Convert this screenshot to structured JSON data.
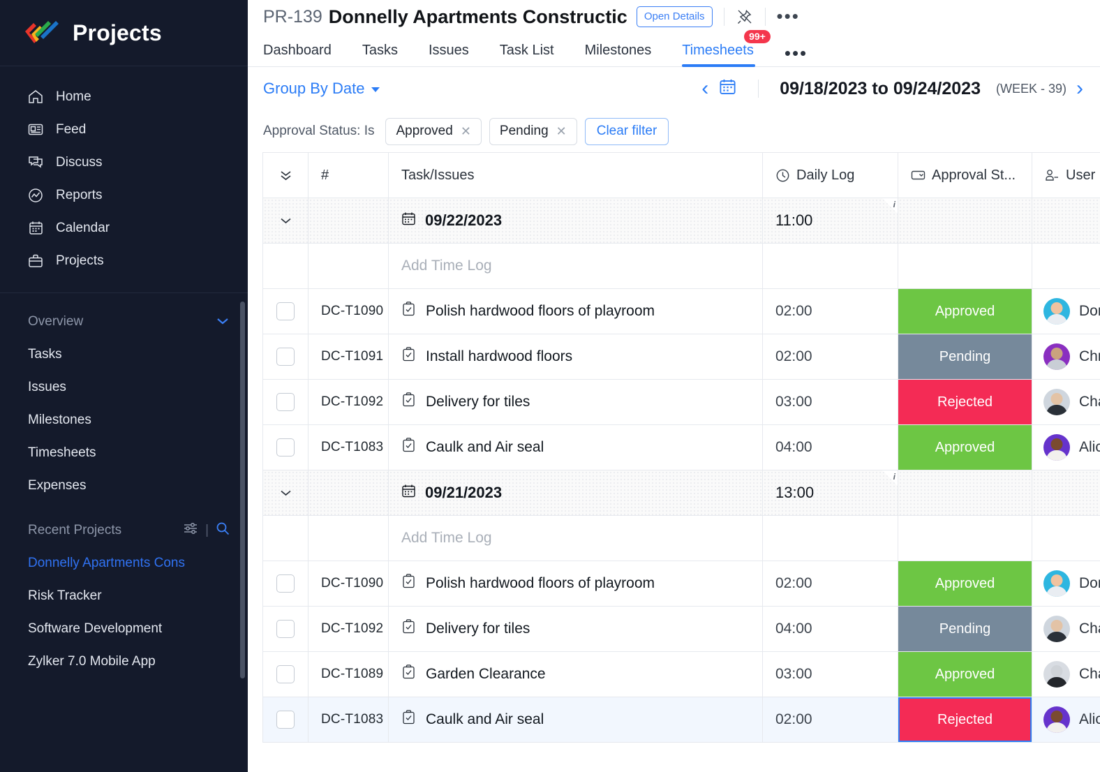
{
  "sidebar": {
    "brand": "Projects",
    "nav": [
      {
        "label": "Home",
        "icon": "home-icon"
      },
      {
        "label": "Feed",
        "icon": "feed-icon"
      },
      {
        "label": "Discuss",
        "icon": "discuss-icon"
      },
      {
        "label": "Reports",
        "icon": "reports-icon"
      },
      {
        "label": "Calendar",
        "icon": "calendar-icon"
      },
      {
        "label": "Projects",
        "icon": "briefcase-icon"
      }
    ],
    "overview": {
      "title": "Overview",
      "items": [
        {
          "label": "Tasks"
        },
        {
          "label": "Issues"
        },
        {
          "label": "Milestones"
        },
        {
          "label": "Timesheets"
        },
        {
          "label": "Expenses"
        }
      ]
    },
    "recent": {
      "title": "Recent Projects",
      "items": [
        {
          "label": "Donnelly Apartments Cons",
          "active": true
        },
        {
          "label": "Risk Tracker",
          "active": false
        },
        {
          "label": "Software Development",
          "active": false
        },
        {
          "label": "Zylker 7.0 Mobile App",
          "active": false
        }
      ]
    }
  },
  "header": {
    "project_id": "PR-139",
    "project_name": "Donnelly Apartments Constructic",
    "open_details_label": "Open Details",
    "pin_icon": "unpin-icon",
    "more_icon": "more-options-icon"
  },
  "tabs": [
    {
      "label": "Dashboard",
      "active": false
    },
    {
      "label": "Tasks",
      "active": false
    },
    {
      "label": "Issues",
      "active": false
    },
    {
      "label": "Task List",
      "active": false
    },
    {
      "label": "Milestones",
      "active": false
    },
    {
      "label": "Timesheets",
      "active": true,
      "badge": "99+"
    }
  ],
  "toolbar": {
    "group_by_label": "Group By Date",
    "date_range": "09/18/2023 to 09/24/2023",
    "week_label": "(WEEK - 39)",
    "prev_icon": "chevron-left-icon",
    "next_icon": "chevron-right-icon",
    "calendar_icon": "calendar-picker-icon"
  },
  "filters": {
    "label": "Approval Status: Is",
    "chips": [
      {
        "label": "Approved"
      },
      {
        "label": "Pending"
      }
    ],
    "clear_label": "Clear filter"
  },
  "table": {
    "columns": [
      {
        "key": "expand",
        "label": "",
        "icon": "collapse-all-icon"
      },
      {
        "key": "num",
        "label": "#",
        "icon": ""
      },
      {
        "key": "task",
        "label": "Task/Issues",
        "icon": ""
      },
      {
        "key": "log",
        "label": "Daily Log",
        "icon": "clock-icon"
      },
      {
        "key": "approval",
        "label": "Approval St...",
        "icon": "dropdown-field-icon"
      },
      {
        "key": "user",
        "label": "User",
        "icon": "user-icon"
      }
    ],
    "add_time_log_label": "Add Time Log",
    "groups": [
      {
        "date": "09/22/2023",
        "total": "11:00",
        "rows": [
          {
            "id": "DC-T1090",
            "task": "Polish hardwood floors of playroom",
            "log": "02:00",
            "status": "Approved",
            "status_key": "approved",
            "user": "Don",
            "avatar_color": "#2eb6e0",
            "selected": false
          },
          {
            "id": "DC-T1091",
            "task": "Install hardwood floors",
            "log": "02:00",
            "status": "Pending",
            "status_key": "pending",
            "user": "Chr",
            "avatar_color": "#8a2fc0",
            "selected": false
          },
          {
            "id": "DC-T1092",
            "task": "Delivery for tiles",
            "log": "03:00",
            "status": "Rejected",
            "status_key": "rejected",
            "user": "Cha",
            "avatar_color": "#cfd6de",
            "selected": false
          },
          {
            "id": "DC-T1083",
            "task": "Caulk and Air seal",
            "log": "04:00",
            "status": "Approved",
            "status_key": "approved",
            "user": "Alic",
            "avatar_color": "#6633cc",
            "selected": false
          }
        ]
      },
      {
        "date": "09/21/2023",
        "total": "13:00",
        "rows": [
          {
            "id": "DC-T1090",
            "task": "Polish hardwood floors of playroom",
            "log": "02:00",
            "status": "Approved",
            "status_key": "approved",
            "user": "Don",
            "avatar_color": "#2eb6e0",
            "selected": false
          },
          {
            "id": "DC-T1092",
            "task": "Delivery for tiles",
            "log": "04:00",
            "status": "Pending",
            "status_key": "pending",
            "user": "Cha",
            "avatar_color": "#cfd6de",
            "selected": false
          },
          {
            "id": "DC-T1089",
            "task": "Garden Clearance",
            "log": "03:00",
            "status": "Approved",
            "status_key": "approved",
            "user": "Cha",
            "avatar_color": "#d8dce2",
            "selected": false
          },
          {
            "id": "DC-T1083",
            "task": "Caulk and Air seal",
            "log": "02:00",
            "status": "Rejected",
            "status_key": "rejected",
            "user": "Alic",
            "avatar_color": "#6633cc",
            "selected": true
          }
        ]
      }
    ]
  },
  "colors": {
    "approved": "#6dc644",
    "pending": "#76899b",
    "rejected": "#f42b55",
    "accent": "#2b7cf6",
    "sidebar_bg": "#141a2b",
    "badge_red": "#f4364c"
  }
}
